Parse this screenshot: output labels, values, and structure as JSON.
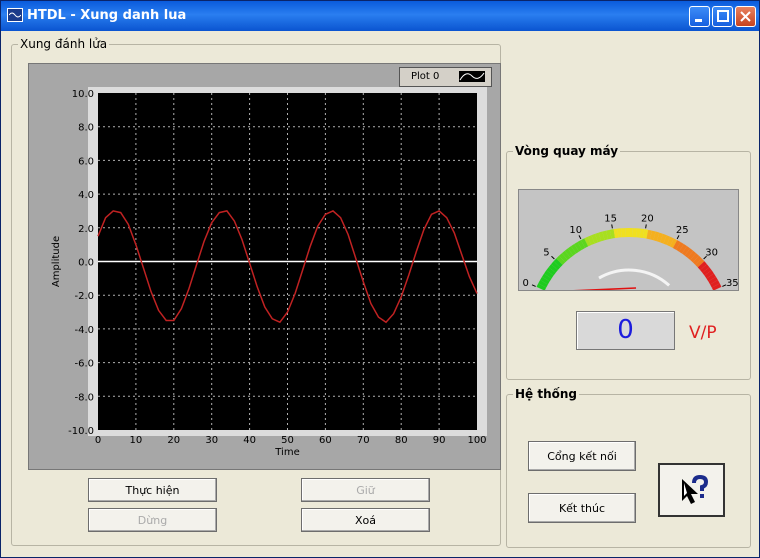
{
  "window": {
    "title": "HTDL - Xung danh lua",
    "controls": [
      "minimize",
      "maximize",
      "close"
    ]
  },
  "chart_group": {
    "label": "Xung đánh lửa"
  },
  "legend": {
    "plot_label": "Plot 0"
  },
  "buttons": {
    "thuc_hien": "Thực hiện",
    "dung": "Dừng",
    "giu": "Giữ",
    "xoa": "Xoá",
    "cong_ket_noi": "Cổng kết nối",
    "ket_thuc": "Kết thúc"
  },
  "rpm_group": {
    "label": "Vòng quay máy"
  },
  "system_group": {
    "label": "Hệ thống"
  },
  "gauge": {
    "ticks": [
      "0",
      "5",
      "10",
      "15",
      "20",
      "25",
      "30",
      "35"
    ],
    "min": 0,
    "max": 35,
    "value": 0
  },
  "readout": {
    "value": "0",
    "unit": "V/P"
  },
  "colors": {
    "plot_bg": "#000000",
    "trace": "#c02222",
    "zero_line": "#ffffff",
    "grid": "#b0b0b0"
  },
  "chart_data": {
    "type": "line",
    "xlabel": "Time",
    "ylabel": "Amplitude",
    "xlim": [
      0,
      100
    ],
    "ylim": [
      -10,
      10
    ],
    "xticks": [
      "0",
      "10",
      "20",
      "30",
      "40",
      "50",
      "60",
      "70",
      "80",
      "90",
      "100"
    ],
    "yticks": [
      "10.0",
      "8.0",
      "6.0",
      "4.0",
      "2.0",
      "0.0",
      "-2.0",
      "-4.0",
      "-6.0",
      "-8.0",
      "-10.0"
    ],
    "grid": true,
    "series": [
      {
        "name": "Plot 0",
        "color": "#c02222",
        "x": [
          0,
          2,
          4,
          6,
          8,
          10,
          12,
          14,
          16,
          18,
          20,
          22,
          24,
          26,
          28,
          30,
          32,
          34,
          36,
          38,
          40,
          42,
          44,
          46,
          48,
          50,
          52,
          54,
          56,
          58,
          60,
          62,
          64,
          66,
          68,
          70,
          72,
          74,
          76,
          78,
          80,
          82,
          84,
          86,
          88,
          90,
          92,
          94,
          96,
          98,
          100
        ],
        "y": [
          1.5,
          2.6,
          3.0,
          2.9,
          2.2,
          1.0,
          -0.4,
          -1.8,
          -2.9,
          -3.5,
          -3.5,
          -2.8,
          -1.6,
          -0.2,
          1.2,
          2.3,
          2.9,
          3.0,
          2.4,
          1.3,
          -0.1,
          -1.5,
          -2.7,
          -3.4,
          -3.6,
          -3.0,
          -1.9,
          -0.5,
          0.9,
          2.1,
          2.8,
          3.0,
          2.6,
          1.6,
          0.2,
          -1.2,
          -2.5,
          -3.3,
          -3.6,
          -3.1,
          -2.1,
          -0.8,
          0.6,
          1.9,
          2.8,
          3.0,
          2.6,
          1.7,
          0.4,
          -0.9,
          -1.9
        ]
      }
    ]
  }
}
